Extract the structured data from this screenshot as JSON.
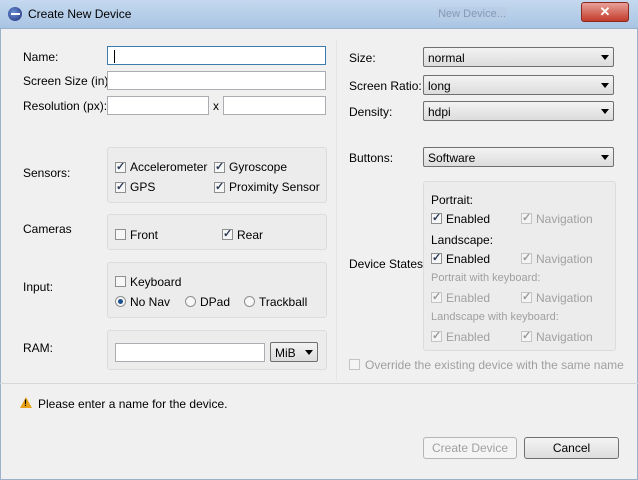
{
  "window": {
    "title": "Create New Device",
    "ghost_button": "New Device...",
    "close_glyph": "✕"
  },
  "left": {
    "name_label": "Name:",
    "name_value": "",
    "screen_size_label": "Screen Size (in):",
    "screen_size_value": "",
    "resolution_label": "Resolution (px):",
    "resolution_x_value": "",
    "resolution_sep": "x",
    "resolution_y_value": "",
    "sensors_label": "Sensors:",
    "sensors": [
      {
        "label": "Accelerometer",
        "checked": true
      },
      {
        "label": "Gyroscope",
        "checked": true
      },
      {
        "label": "GPS",
        "checked": true
      },
      {
        "label": "Proximity Sensor",
        "checked": true
      }
    ],
    "cameras_label": "Cameras",
    "cameras": [
      {
        "label": "Front",
        "checked": false
      },
      {
        "label": "Rear",
        "checked": true
      }
    ],
    "input_label": "Input:",
    "keyboard": {
      "label": "Keyboard",
      "checked": false
    },
    "nav": [
      {
        "label": "No Nav",
        "selected": true
      },
      {
        "label": "DPad",
        "selected": false
      },
      {
        "label": "Trackball",
        "selected": false
      }
    ],
    "ram_label": "RAM:",
    "ram_value": "",
    "ram_unit": "MiB"
  },
  "right": {
    "size_label": "Size:",
    "size_value": "normal",
    "ratio_label": "Screen Ratio:",
    "ratio_value": "long",
    "density_label": "Density:",
    "density_value": "hdpi",
    "buttons_label": "Buttons:",
    "buttons_value": "Software",
    "device_states_label": "Device States:",
    "states": [
      {
        "heading": "Portrait:",
        "enabled_label": "Enabled",
        "nav_label": "Navigation",
        "active": true
      },
      {
        "heading": "Landscape:",
        "enabled_label": "Enabled",
        "nav_label": "Navigation",
        "active": true
      },
      {
        "heading": "Portrait with keyboard:",
        "enabled_label": "Enabled",
        "nav_label": "Navigation",
        "active": false
      },
      {
        "heading": "Landscape with keyboard:",
        "enabled_label": "Enabled",
        "nav_label": "Navigation",
        "active": false
      }
    ],
    "override_label": "Override the existing device with the same name"
  },
  "footer": {
    "warning": "Please enter a name for the device.",
    "create_label": "Create Device",
    "cancel_label": "Cancel"
  }
}
